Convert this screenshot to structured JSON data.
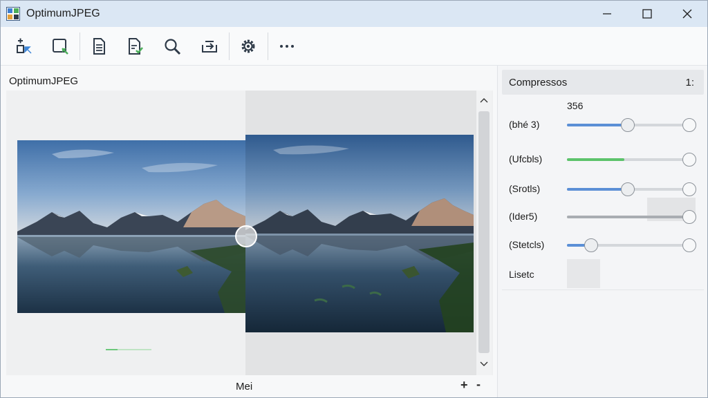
{
  "window": {
    "title": "OptimumJPEG",
    "minimize_icon": "minimize-icon",
    "maximize_icon": "maximize-icon",
    "close_icon": "close-icon"
  },
  "toolbar": {
    "buttons": [
      {
        "name": "add-files-button",
        "icon": "add-files-icon"
      },
      {
        "name": "select-area-button",
        "icon": "crop-select-icon"
      },
      {
        "name": "document-button",
        "icon": "document-icon"
      },
      {
        "name": "save-document-button",
        "icon": "document-check-icon"
      },
      {
        "name": "zoom-button",
        "icon": "magnifier-icon"
      },
      {
        "name": "export-button",
        "icon": "tray-arrow-icon"
      },
      {
        "name": "settings-button",
        "icon": "gear-icon"
      },
      {
        "name": "more-button",
        "icon": "more-dots-icon"
      }
    ]
  },
  "viewer": {
    "panel_label": "OptimumJPEG",
    "bottom_label": "Mei",
    "zoom_in": "+",
    "zoom_out": "-",
    "original_image": "mountain-lake-original",
    "optimized_image": "mountain-lake-optimized",
    "progress": 0.25
  },
  "settings_panel": {
    "title": "Compressos",
    "value": "1:",
    "top_value": "356",
    "sliders": [
      {
        "label": "(bhé 3)",
        "value": 0.5,
        "color": "#5b8fd6"
      },
      {
        "label": "(Ufcbls)",
        "value": 0.47,
        "color": "#5cc36b"
      },
      {
        "label": "(Srotls)",
        "value": 0.5,
        "color": "#5b8fd6"
      },
      {
        "label": "(Ider5)",
        "value": 0.98,
        "color": "#a9adb2"
      },
      {
        "label": "(Stetcls)",
        "value": 0.2,
        "color": "#5b8fd6"
      }
    ],
    "preset_label": "Lisetc"
  },
  "colors": {
    "titlebar": "#dbe7f4",
    "accent_blue": "#5b8fd6",
    "accent_green": "#5cc36b"
  }
}
